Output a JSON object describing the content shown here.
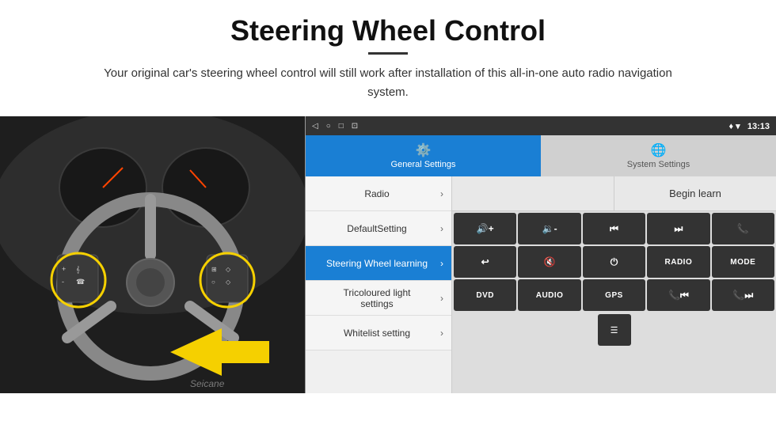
{
  "header": {
    "title": "Steering Wheel Control",
    "subtitle": "Your original car's steering wheel control will still work after installation of this all-in-one auto radio navigation system."
  },
  "status_bar": {
    "icons": [
      "◁",
      "○",
      "□",
      "⊡"
    ],
    "right_icons": "♦ ▼",
    "time": "13:13"
  },
  "tabs": [
    {
      "id": "general",
      "label": "General Settings",
      "active": true
    },
    {
      "id": "system",
      "label": "System Settings",
      "active": false
    }
  ],
  "menu_items": [
    {
      "id": "radio",
      "label": "Radio",
      "active": false
    },
    {
      "id": "default",
      "label": "DefaultSetting",
      "active": false
    },
    {
      "id": "steering",
      "label": "Steering Wheel learning",
      "active": true
    },
    {
      "id": "tricoloured",
      "label": "Tricoloured light settings",
      "active": false
    },
    {
      "id": "whitelist",
      "label": "Whitelist setting",
      "active": false
    }
  ],
  "begin_learn_label": "Begin learn",
  "grid_buttons": [
    {
      "id": "vol_up",
      "icon": "🔊+",
      "type": "icon"
    },
    {
      "id": "vol_down",
      "icon": "🔉-",
      "type": "icon"
    },
    {
      "id": "prev_track",
      "icon": "⏮",
      "type": "icon"
    },
    {
      "id": "next_track",
      "icon": "⏭",
      "type": "icon"
    },
    {
      "id": "phone",
      "icon": "📞",
      "type": "icon"
    },
    {
      "id": "hang_up",
      "icon": "↩",
      "type": "icon"
    },
    {
      "id": "mute",
      "icon": "🔇",
      "type": "icon"
    },
    {
      "id": "power",
      "icon": "⏻",
      "type": "icon"
    },
    {
      "id": "radio_btn",
      "label": "RADIO",
      "type": "text"
    },
    {
      "id": "mode_btn",
      "label": "MODE",
      "type": "text"
    },
    {
      "id": "dvd_btn",
      "label": "DVD",
      "type": "text"
    },
    {
      "id": "audio_btn",
      "label": "AUDIO",
      "type": "text"
    },
    {
      "id": "gps_btn",
      "label": "GPS",
      "type": "text"
    },
    {
      "id": "phone2",
      "icon": "📞⏮",
      "type": "icon"
    },
    {
      "id": "ff_btn",
      "icon": "⏭⏭",
      "type": "icon"
    }
  ],
  "bottom_button": {
    "id": "menu_icon",
    "icon": "☰"
  },
  "watermark": "Seicane"
}
